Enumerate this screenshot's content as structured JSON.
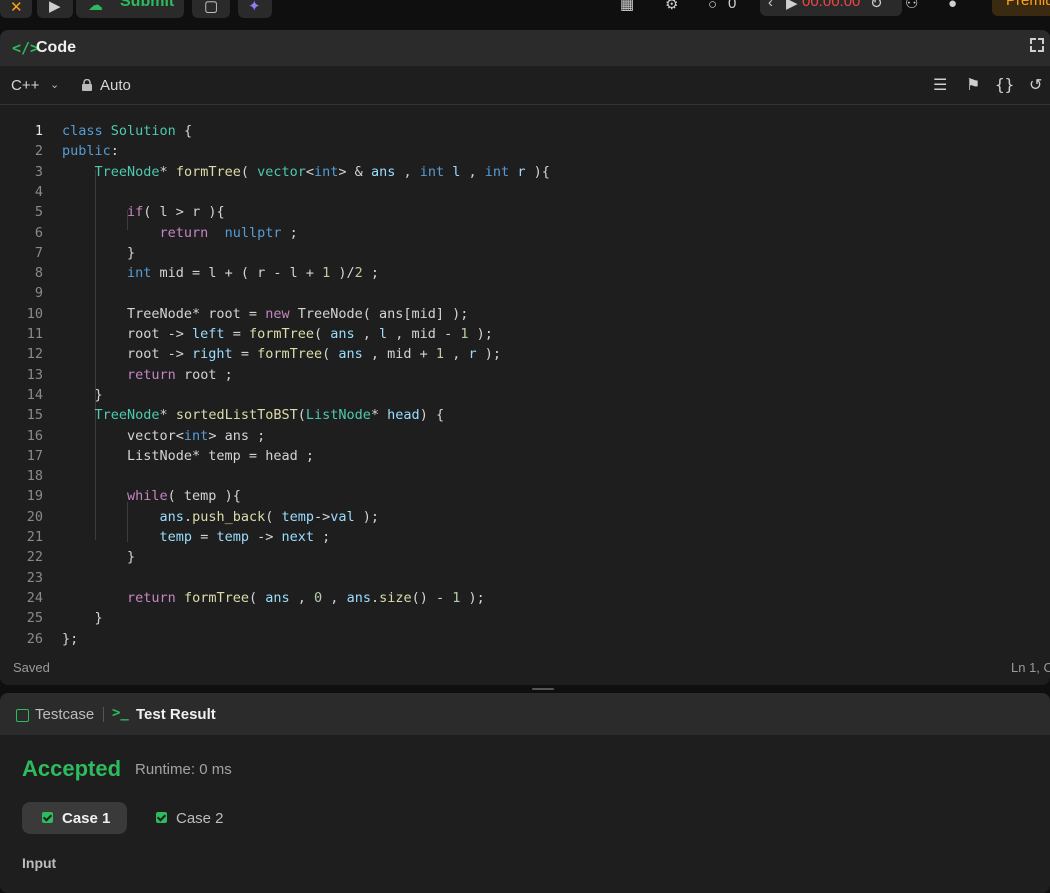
{
  "topbar": {
    "submit_label": "Submit",
    "counter": "0",
    "timer": "00:00:00",
    "premium_label": "Premiu"
  },
  "code_panel": {
    "title": "Code",
    "language": "C++",
    "mode": "Auto",
    "status": "Saved",
    "cursor": "Ln 1, C",
    "lines": [
      "class Solution {",
      "public:",
      "    TreeNode* formTree( vector<int> & ans , int l , int r ){",
      "",
      "        if( l > r ){",
      "            return  nullptr ;",
      "        }",
      "        int mid = l + ( r - l + 1 )/2 ;",
      "",
      "        TreeNode* root = new TreeNode( ans[mid] );",
      "        root -> left = formTree( ans , l , mid - 1 );",
      "        root -> right = formTree( ans , mid + 1 , r );",
      "        return root ;",
      "    }",
      "    TreeNode* sortedListToBST(ListNode* head) {",
      "        vector<int> ans ;",
      "        ListNode* temp = head ;",
      "",
      "        while( temp ){",
      "            ans.push_back( temp->val );",
      "            temp = temp -> next ;",
      "        }",
      "",
      "        return formTree( ans , 0 , ans.size() - 1 );",
      "    }",
      "};"
    ],
    "line_numbers": [
      "1",
      "2",
      "3",
      "4",
      "5",
      "6",
      "7",
      "8",
      "9",
      "10",
      "11",
      "12",
      "13",
      "14",
      "15",
      "16",
      "17",
      "18",
      "19",
      "20",
      "21",
      "22",
      "23",
      "24",
      "25",
      "26"
    ]
  },
  "test_panel": {
    "tab_testcase": "Testcase",
    "tab_result": "Test Result",
    "verdict": "Accepted",
    "runtime": "Runtime: 0 ms",
    "cases": [
      "Case 1",
      "Case 2"
    ],
    "input_label": "Input"
  },
  "colors": {
    "accent_green": "#2cbb5d",
    "timer_red": "#ef4743",
    "premium_orange": "#ffa116"
  }
}
